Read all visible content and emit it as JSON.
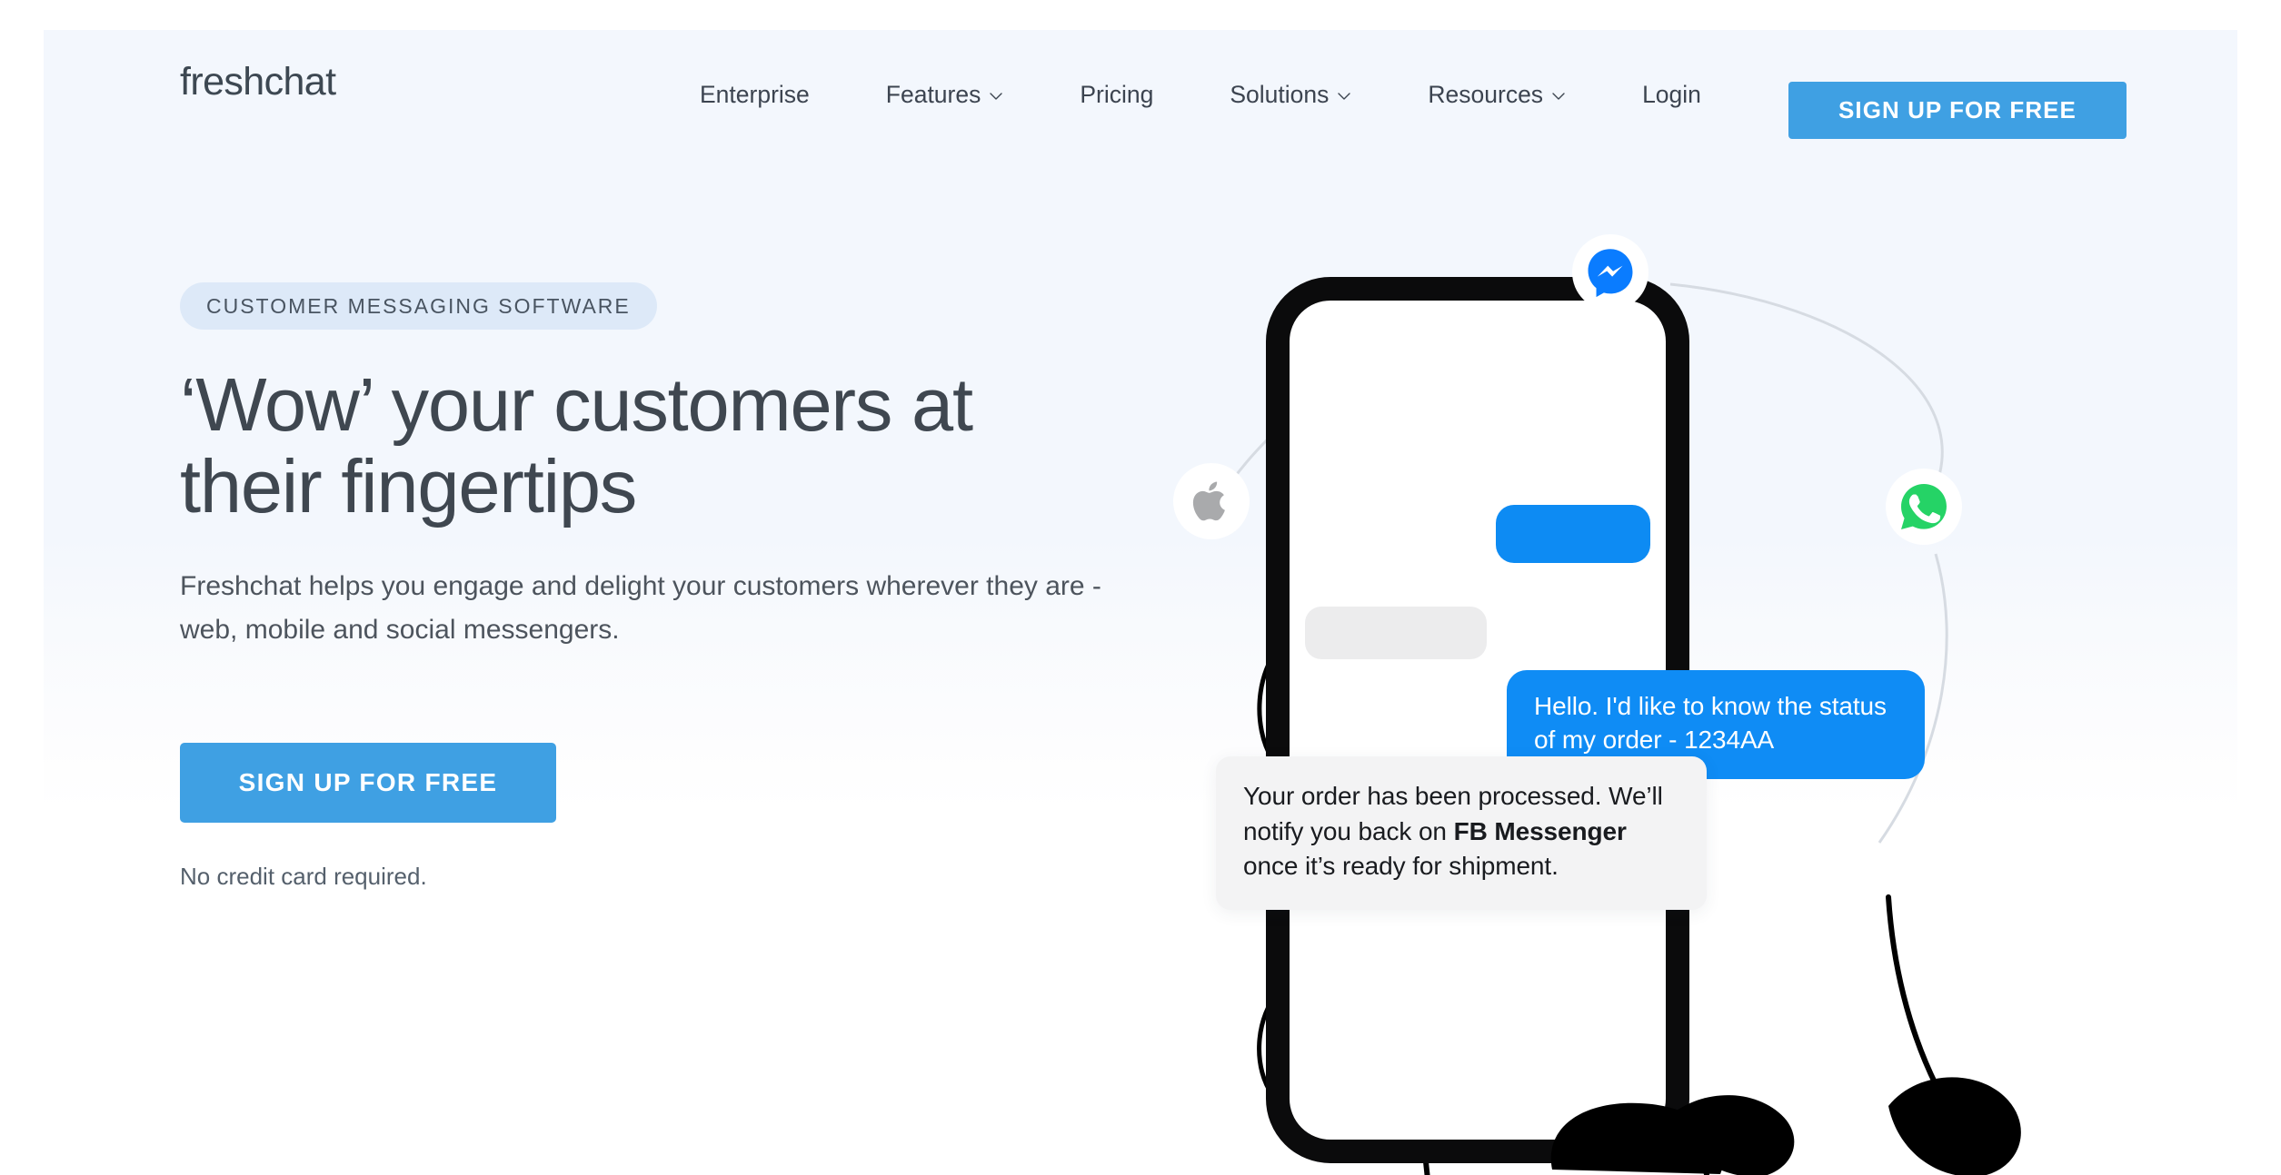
{
  "colors": {
    "page_bg": "#f3f7fd",
    "accent_blue": "#3fa0e3",
    "bubble_blue": "#0f8cf5",
    "pill_bg": "#dde9f8",
    "text_dark": "#3f4750",
    "messenger_blue": "#0a7cff",
    "whatsapp_green": "#25d366",
    "apple_gray": "#a9aaac"
  },
  "header": {
    "logo": "freshchat",
    "nav": [
      {
        "label": "Enterprise",
        "has_dropdown": false
      },
      {
        "label": "Features",
        "has_dropdown": true
      },
      {
        "label": "Pricing",
        "has_dropdown": false
      },
      {
        "label": "Solutions",
        "has_dropdown": true
      },
      {
        "label": "Resources",
        "has_dropdown": true
      },
      {
        "label": "Login",
        "has_dropdown": false
      }
    ],
    "cta_label": "SIGN UP FOR FREE"
  },
  "hero": {
    "eyebrow": "CUSTOMER MESSAGING SOFTWARE",
    "headline_line1": "‘Wow’ your customers at",
    "headline_line2": "their fingertips",
    "subheadline": "Freshchat helps you engage and delight your customers wherever they are - web, mobile and social messengers.",
    "cta_label": "SIGN UP FOR FREE",
    "cta_note": "No credit card required."
  },
  "illustration": {
    "description": "hand-drawn hand holding a smartphone with chat bubbles",
    "badges": [
      {
        "icon": "messenger-icon",
        "name": "Messenger"
      },
      {
        "icon": "apple-icon",
        "name": "Apple"
      },
      {
        "icon": "whatsapp-icon",
        "name": "WhatsApp"
      }
    ],
    "messages": [
      {
        "from": "customer",
        "style": "blue",
        "text": "Hello. I'd like to know the status of my order - 1234AA"
      },
      {
        "from": "agent",
        "style": "white",
        "text_before": "Your order has been processed. We’ll notify you back on ",
        "text_bold": "FB Messenger",
        "text_after": " once it’s ready for shipment."
      }
    ]
  }
}
